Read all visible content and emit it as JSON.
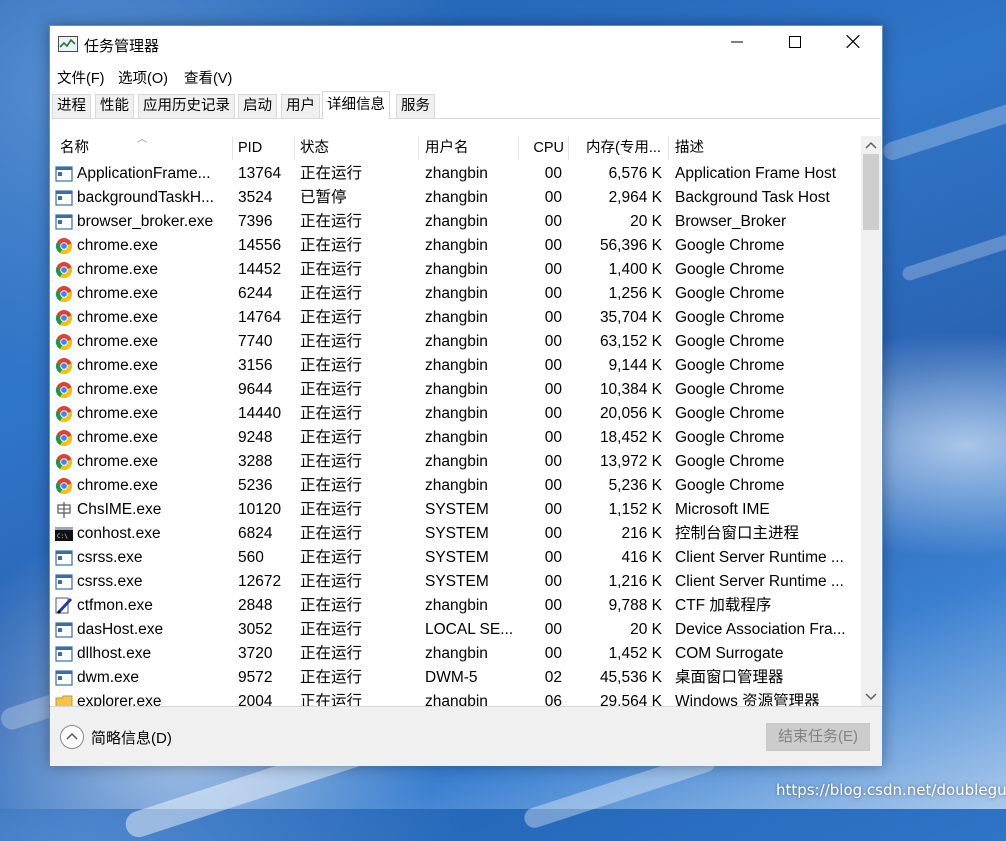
{
  "window": {
    "title": "任务管理器"
  },
  "menu": [
    "文件(F)",
    "选项(O)",
    "查看(V)"
  ],
  "tabs": [
    {
      "label": "进程",
      "active": false
    },
    {
      "label": "性能",
      "active": false
    },
    {
      "label": "应用历史记录",
      "active": false
    },
    {
      "label": "启动",
      "active": false
    },
    {
      "label": "用户",
      "active": false
    },
    {
      "label": "详细信息",
      "active": true
    },
    {
      "label": "服务",
      "active": false
    }
  ],
  "columns": {
    "name": "名称",
    "pid": "PID",
    "status": "状态",
    "user": "用户名",
    "cpu": "CPU",
    "memory": "内存(专用...",
    "description": "描述"
  },
  "rows": [
    {
      "icon": "app-window-icon",
      "name": "ApplicationFrame...",
      "pid": "13764",
      "status": "正在运行",
      "user": "zhangbin",
      "cpu": "00",
      "memory": "6,576 K",
      "description": "Application Frame Host"
    },
    {
      "icon": "app-window-icon",
      "name": "backgroundTaskH...",
      "pid": "3524",
      "status": "已暂停",
      "user": "zhangbin",
      "cpu": "00",
      "memory": "2,964 K",
      "description": "Background Task Host"
    },
    {
      "icon": "app-window-icon",
      "name": "browser_broker.exe",
      "pid": "7396",
      "status": "正在运行",
      "user": "zhangbin",
      "cpu": "00",
      "memory": "20 K",
      "description": "Browser_Broker"
    },
    {
      "icon": "chrome-icon",
      "name": "chrome.exe",
      "pid": "14556",
      "status": "正在运行",
      "user": "zhangbin",
      "cpu": "00",
      "memory": "56,396 K",
      "description": "Google Chrome"
    },
    {
      "icon": "chrome-icon",
      "name": "chrome.exe",
      "pid": "14452",
      "status": "正在运行",
      "user": "zhangbin",
      "cpu": "00",
      "memory": "1,400 K",
      "description": "Google Chrome"
    },
    {
      "icon": "chrome-icon",
      "name": "chrome.exe",
      "pid": "6244",
      "status": "正在运行",
      "user": "zhangbin",
      "cpu": "00",
      "memory": "1,256 K",
      "description": "Google Chrome"
    },
    {
      "icon": "chrome-icon",
      "name": "chrome.exe",
      "pid": "14764",
      "status": "正在运行",
      "user": "zhangbin",
      "cpu": "00",
      "memory": "35,704 K",
      "description": "Google Chrome"
    },
    {
      "icon": "chrome-icon",
      "name": "chrome.exe",
      "pid": "7740",
      "status": "正在运行",
      "user": "zhangbin",
      "cpu": "00",
      "memory": "63,152 K",
      "description": "Google Chrome"
    },
    {
      "icon": "chrome-icon",
      "name": "chrome.exe",
      "pid": "3156",
      "status": "正在运行",
      "user": "zhangbin",
      "cpu": "00",
      "memory": "9,144 K",
      "description": "Google Chrome"
    },
    {
      "icon": "chrome-icon",
      "name": "chrome.exe",
      "pid": "9644",
      "status": "正在运行",
      "user": "zhangbin",
      "cpu": "00",
      "memory": "10,384 K",
      "description": "Google Chrome"
    },
    {
      "icon": "chrome-icon",
      "name": "chrome.exe",
      "pid": "14440",
      "status": "正在运行",
      "user": "zhangbin",
      "cpu": "00",
      "memory": "20,056 K",
      "description": "Google Chrome"
    },
    {
      "icon": "chrome-icon",
      "name": "chrome.exe",
      "pid": "9248",
      "status": "正在运行",
      "user": "zhangbin",
      "cpu": "00",
      "memory": "18,452 K",
      "description": "Google Chrome"
    },
    {
      "icon": "chrome-icon",
      "name": "chrome.exe",
      "pid": "3288",
      "status": "正在运行",
      "user": "zhangbin",
      "cpu": "00",
      "memory": "13,972 K",
      "description": "Google Chrome"
    },
    {
      "icon": "chrome-icon",
      "name": "chrome.exe",
      "pid": "5236",
      "status": "正在运行",
      "user": "zhangbin",
      "cpu": "00",
      "memory": "5,236 K",
      "description": "Google Chrome"
    },
    {
      "icon": "ime-icon",
      "name": "ChsIME.exe",
      "pid": "10120",
      "status": "正在运行",
      "user": "SYSTEM",
      "cpu": "00",
      "memory": "1,152 K",
      "description": "Microsoft IME"
    },
    {
      "icon": "console-icon",
      "name": "conhost.exe",
      "pid": "6824",
      "status": "正在运行",
      "user": "SYSTEM",
      "cpu": "00",
      "memory": "216 K",
      "description": "控制台窗口主进程"
    },
    {
      "icon": "app-window-icon",
      "name": "csrss.exe",
      "pid": "560",
      "status": "正在运行",
      "user": "SYSTEM",
      "cpu": "00",
      "memory": "416 K",
      "description": "Client Server Runtime ..."
    },
    {
      "icon": "app-window-icon",
      "name": "csrss.exe",
      "pid": "12672",
      "status": "正在运行",
      "user": "SYSTEM",
      "cpu": "00",
      "memory": "1,216 K",
      "description": "Client Server Runtime ..."
    },
    {
      "icon": "pen-icon",
      "name": "ctfmon.exe",
      "pid": "2848",
      "status": "正在运行",
      "user": "zhangbin",
      "cpu": "00",
      "memory": "9,788 K",
      "description": "CTF 加载程序"
    },
    {
      "icon": "app-window-icon",
      "name": "dasHost.exe",
      "pid": "3052",
      "status": "正在运行",
      "user": "LOCAL SE...",
      "cpu": "00",
      "memory": "20 K",
      "description": "Device Association Fra..."
    },
    {
      "icon": "app-window-icon",
      "name": "dllhost.exe",
      "pid": "3720",
      "status": "正在运行",
      "user": "zhangbin",
      "cpu": "00",
      "memory": "1,452 K",
      "description": "COM Surrogate"
    },
    {
      "icon": "app-window-icon",
      "name": "dwm.exe",
      "pid": "9572",
      "status": "正在运行",
      "user": "DWM-5",
      "cpu": "02",
      "memory": "45,536 K",
      "description": "桌面窗口管理器"
    },
    {
      "icon": "folder-icon",
      "name": "explorer.exe",
      "pid": "2004",
      "status": "正在运行",
      "user": "zhangbin",
      "cpu": "06",
      "memory": "29,564 K",
      "description": "Windows 资源管理器"
    }
  ],
  "footer": {
    "fewer_details": "简略信息(D)",
    "end_task": "结束任务(E)"
  },
  "watermark": "https://blog.csdn.net/doubleguy"
}
